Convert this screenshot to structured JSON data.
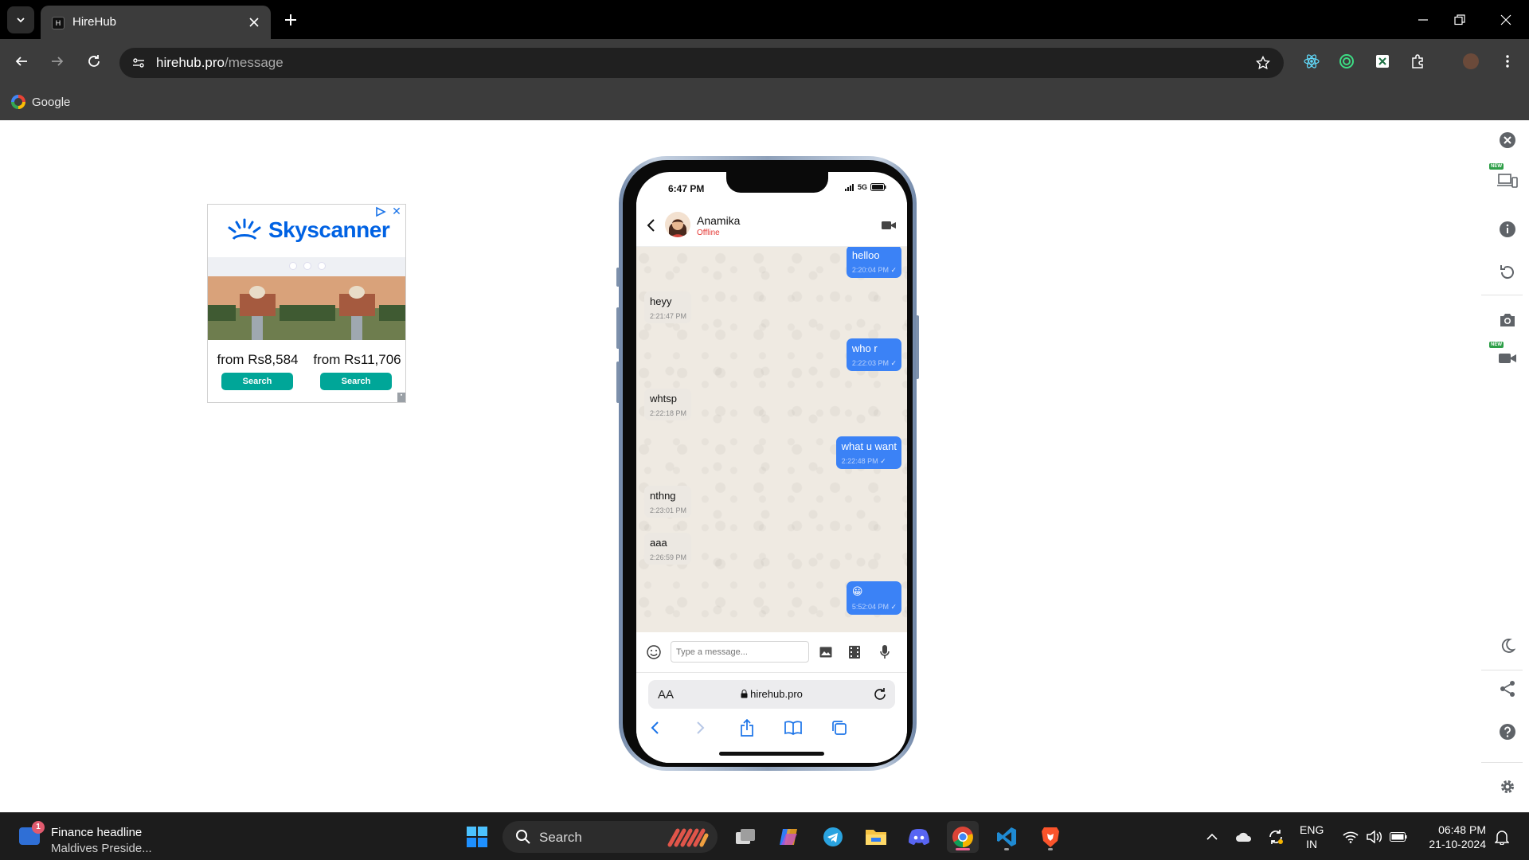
{
  "browser": {
    "tab_title": "HireHub",
    "tab_favicon_text": "H",
    "url_host": "hirehub.pro",
    "url_path": "/message",
    "bookmark_label": "Google"
  },
  "ad": {
    "brand": "Skyscanner",
    "offers": [
      {
        "price": "from Rs8,584",
        "button": "Search"
      },
      {
        "price": "from Rs11,706",
        "button": "Search"
      }
    ],
    "brand_color": "#0062e3",
    "button_color": "#00a698"
  },
  "phone": {
    "time": "6:47 PM",
    "network": "5G",
    "contact_name": "Anamika",
    "contact_status": "Offline",
    "messages": [
      {
        "dir": "out",
        "text": "helloo",
        "time": "2:20:04 PM"
      },
      {
        "dir": "in",
        "text": "heyy",
        "time": "2:21:47 PM"
      },
      {
        "dir": "out",
        "text": "who r",
        "time": "2:22:03 PM"
      },
      {
        "dir": "in",
        "text": "whtsp",
        "time": "2:22:18 PM"
      },
      {
        "dir": "out",
        "text": "what u want",
        "time": "2:22:48 PM"
      },
      {
        "dir": "in",
        "text": "nthng",
        "time": "2:23:01 PM"
      },
      {
        "dir": "in",
        "text": "aaa",
        "time": "2:26:59 PM"
      },
      {
        "dir": "out",
        "text": "😀",
        "time": "5:52:04 PM"
      }
    ],
    "input_placeholder": "Type a message...",
    "safari_aa": "AA",
    "safari_url": "hirehub.pro",
    "outgoing_color": "#3b82f6",
    "status_offline_color": "#e53935"
  },
  "taskbar": {
    "news_badge": "1",
    "news_title": "Finance headline",
    "news_sub": "Maldives Preside...",
    "search_label": "Search",
    "lang_line1": "ENG",
    "lang_line2": "IN",
    "clock_time": "06:48 PM",
    "clock_date": "21-10-2024"
  }
}
